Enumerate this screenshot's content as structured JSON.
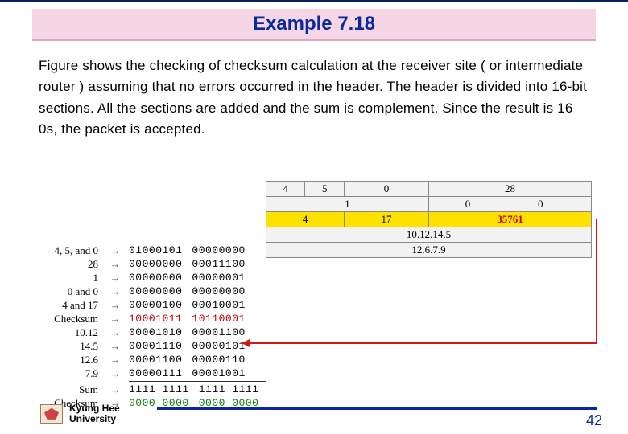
{
  "title": "Example 7.18",
  "body": "Figure shows the checking of checksum calculation at the receiver site ( or intermediate router ) assuming that no errors occurred in the header. The header is divided into 16-bit sections. All the sections are added and the sum is complement. Since the result is 16 0s, the packet is accepted.",
  "header_table": {
    "r1": {
      "c1": "4",
      "c2": "5",
      "c3": "0",
      "c4": "28"
    },
    "r2": {
      "c1": "1",
      "c2": "0",
      "c3": "0"
    },
    "r3": {
      "c1": "4",
      "c2": "17",
      "c3": "35761"
    },
    "r4": "10.12.14.5",
    "r5": "12.6.7.9"
  },
  "calc": {
    "labels": {
      "l1": "4, 5, and 0",
      "l2": "28",
      "l3": "1",
      "l4": "0 and 0",
      "l5": "4 and 17",
      "l6": "Checksum",
      "l7": "10.12",
      "l8": "14.5",
      "l9": "12.6",
      "l10": "7.9",
      "sum": "Sum",
      "chks": "Checksum"
    },
    "bits": {
      "b1a": "01000101",
      "b1b": "00000000",
      "b2a": "00000000",
      "b2b": "00011100",
      "b3a": "00000000",
      "b3b": "00000001",
      "b4a": "00000000",
      "b4b": "00000000",
      "b5a": "00000100",
      "b5b": "00010001",
      "b6a": "10001011",
      "b6b": "10110001",
      "b7a": "00001010",
      "b7b": "00001100",
      "b8a": "00001110",
      "b8b": "00000101",
      "b9a": "00001100",
      "b9b": "00000110",
      "b10a": "00000111",
      "b10b": "00001001",
      "suma": "1111 1111",
      "sumb": "1111 1111",
      "chka": "0000 0000",
      "chkb": "0000 0000"
    }
  },
  "footer": {
    "uni1": "Kyung Hee",
    "uni2": "University",
    "page": "42"
  }
}
